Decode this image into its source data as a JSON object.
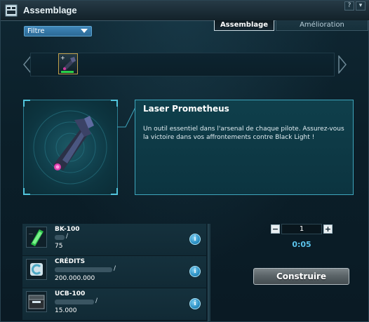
{
  "window": {
    "title": "Assemblage",
    "buttons": [
      "?",
      "▾"
    ]
  },
  "filter": {
    "label": "Filtre"
  },
  "tabs": [
    {
      "label": "Assemblage",
      "active": true
    },
    {
      "label": "Amélioration",
      "active": false
    }
  ],
  "item": {
    "name": "Laser Prometheus",
    "description": "Un outil essentiel dans l'arsenal de chaque pilote. Assurez-vous la victoire dans vos affrontements contre Black Light !",
    "slot_icon": "prometheus-laser-icon",
    "preview_icon": "prometheus-laser-icon"
  },
  "ingredients": [
    {
      "name": "BK-100",
      "amount": "75",
      "icon": "bk100-green-card-icon"
    },
    {
      "name": "CRÉDITS",
      "amount": "200.000.000",
      "icon": "credits-icon"
    },
    {
      "name": "UCB-100",
      "amount": "15.000",
      "icon": "ucb100-ammo-box-icon"
    }
  ],
  "quantity": {
    "value": "1",
    "minus": "−",
    "plus": "+"
  },
  "timer": "0:05",
  "build_button": "Construire",
  "colors": {
    "accent": "#3ea6bd",
    "timer": "#5cc4ec",
    "filter": "#2c6a96"
  }
}
